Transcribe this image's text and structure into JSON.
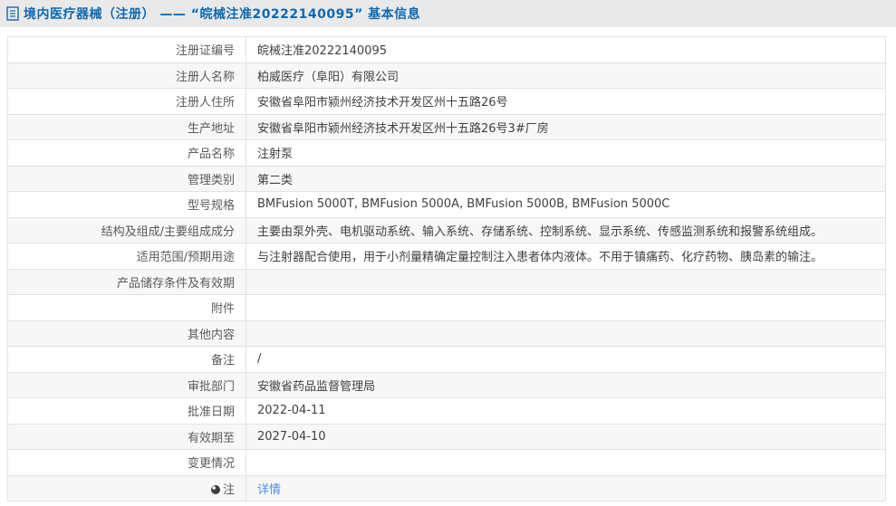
{
  "header": {
    "icon": "document-icon",
    "full_title": "境内医疗器械（注册） —— “皖械注准20222140095” 基本信息"
  },
  "colors": {
    "title_blue": "#0d68b1",
    "link_blue": "#4a8fe4",
    "header_bar_bg": "#e9e9e9",
    "row_alt_bg": "#f7f7f7",
    "table_border": "#c9c9cd"
  },
  "table": {
    "rows": [
      {
        "label": "注册证编号",
        "value": "皖械注准20222140095"
      },
      {
        "label": "注册人名称",
        "value": "柏威医疗（阜阳）有限公司"
      },
      {
        "label": "注册人住所",
        "value": "安徽省阜阳市颍州经济技术开发区州十五路26号"
      },
      {
        "label": "生产地址",
        "value": "安徽省阜阳市颍州经济技术开发区州十五路26号3#厂房"
      },
      {
        "label": "产品名称",
        "value": "注射泵"
      },
      {
        "label": "管理类别",
        "value": "第二类"
      },
      {
        "label": "型号规格",
        "value": "BMFusion 5000T, BMFusion 5000A, BMFusion 5000B, BMFusion 5000C"
      },
      {
        "label": "结构及组成/主要组成成分",
        "value": "主要由泵外壳、电机驱动系统、输入系统、存储系统、控制系统、显示系统、传感监测系统和报警系统组成。"
      },
      {
        "label": "适用范围/预期用途",
        "value": "与注射器配合使用，用于小剂量精确定量控制注入患者体内液体。不用于镇痛药、化疗药物、胰岛素的输注。"
      },
      {
        "label": "产品储存条件及有效期",
        "value": ""
      },
      {
        "label": "附件",
        "value": ""
      },
      {
        "label": "其他内容",
        "value": ""
      },
      {
        "label": "备注",
        "value": "/"
      },
      {
        "label": "审批部门",
        "value": "安徽省药品监督管理局"
      },
      {
        "label": "批准日期",
        "value": "2022-04-11"
      },
      {
        "label": "有效期至",
        "value": "2027-04-10"
      },
      {
        "label": "变更情况",
        "value": ""
      },
      {
        "label": "注",
        "label_icon": "note-bullet-icon",
        "value": "详情",
        "value_is_link": true
      }
    ]
  }
}
